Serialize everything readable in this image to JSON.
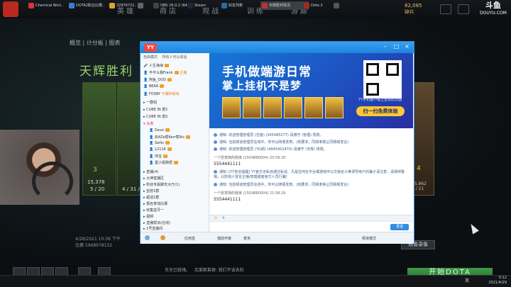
{
  "dota": {
    "nav": [
      "英雄",
      "商店",
      "观战",
      "训练",
      "游廊"
    ],
    "subtabs": "概览  |  计分板  |  图表",
    "victory": "天辉胜利",
    "shards": "82,085",
    "shards_label": "碎片",
    "douyu": "斗鱼",
    "douyu_url": "DOUYU.COM",
    "left_hero_stat_a": "3",
    "left_hero_stat_b": "15,378",
    "left_hero_kda": "5 / 20",
    "left_hero2_kda": "4 / 31 / 18",
    "right_hero_num": "4",
    "right_hero_stat": "15,862",
    "right_hero_kda": "4 / 21",
    "match_date": "4/28/2021 10:36 下午",
    "match_id": "比赛 5968978152",
    "view_button": "观看录像",
    "feed": "东东已就绪。",
    "feed2": "克莱斯莱顿: 我们不该去的",
    "start_button": "开始DOTA"
  },
  "yy": {
    "title_logo": "YY",
    "tabs": [
      "房间",
      "设置",
      "更多"
    ],
    "left_header": "自由模式",
    "left_header_right": "所有人可以说话",
    "users": [
      {
        "name": "人生海海",
        "extra": ""
      },
      {
        "name": "平平么我Frank",
        "extra": "主播"
      },
      {
        "name": "阿鱼_DOD",
        "extra": ""
      },
      {
        "name": "BEAR",
        "extra": ""
      },
      {
        "name": "FOSBY",
        "extra": "不服你就来"
      }
    ],
    "groups": [
      "▸ 一群组",
      "▸ CUBE IN 部1",
      "▸ CUBE IN 部2",
      "▾ 大虎"
    ],
    "sub_users": [
      "Dave",
      "双4Ze帮Kerr帮Ric",
      "Sailis",
      "12116",
      "帅宝",
      "墨小姐随便"
    ],
    "more_groups": [
      "▸ 直播(4)",
      "▸ 大神直播区",
      "▸ 粉丝专属聊天大厅(1)",
      "▸ 监管1群",
      "▸ 超话1群",
      "▸ 报名参加比赛",
      "▸ 收集蓝牙一",
      "▸ 视频",
      "▸ 直播帮派(在线)",
      "   ▸ 1号直播间"
    ],
    "banner_line1": "手机做端游日常",
    "banner_line2": "掌上挂机不是梦",
    "qr_caption": "YY手机客户端上登录此页面",
    "qr_button": "扫一扫免费体验",
    "chat": [
      {
        "type": "sys",
        "text": "通知: 欢迎管理管理员 (住客) (345485277) 请遵守 (管理) 规则。"
      },
      {
        "type": "sys",
        "text": "通知: 当前频道管理员在线中，你可以随便发表。(有要求，同频率禁止同频频发言)"
      },
      {
        "type": "sys",
        "text": "通知: 欢迎管理管理员 (YG频) (4945452470) 请遵守 (天辉) 规则。"
      },
      {
        "type": "me",
        "text": "一个愿意随的我家 (1554880004) 20:59:20"
      },
      {
        "type": "num",
        "text": "5554441111"
      },
      {
        "type": "sys",
        "text": "通知: [YY安全提醒] YY官方无私自通过私信、凡是任何在平台或游戏中以交易名义等诱导用户的骗子请注意，请保持警惕，以防他人冒充主播/管理或者官方人员行骗!"
      },
      {
        "type": "sys",
        "text": "通知: 当前频道管理员在线中，你可以随便发表。(有要求，同频率禁止同频频发言)"
      },
      {
        "type": "me",
        "text": "一个愿意随的我家 (1554880004) 21:58:29"
      },
      {
        "type": "num",
        "text": "5554441111"
      }
    ],
    "input_placeholder": "",
    "send_label": "发送",
    "bottom_items": [
      "应用盒",
      "播放伴奏",
      "麦克"
    ],
    "bottom_right": "频道模式"
  },
  "taskbar": {
    "items": [
      {
        "label": "Chemical Worl..",
        "color": "#d33"
      },
      {
        "label": "DOTA2职业比赛..",
        "color": "#3a7bd5"
      },
      {
        "label": "32976721..",
        "color": "#e8a030"
      },
      {
        "label": "",
        "color": "#666"
      },
      {
        "label": "OBS 26.0.2 (64..",
        "color": "#444"
      },
      {
        "label": "Steam",
        "color": "#1b2838"
      },
      {
        "label": "好友列表",
        "color": "#2d6a9a"
      },
      {
        "label": "天辉胜利情况",
        "color": "#b33"
      },
      {
        "label": "Dota 2",
        "color": "#a52a1e"
      },
      {
        "label": "",
        "color": "#555"
      }
    ],
    "time": "0:12",
    "date": "2021/4/29",
    "lang": "英"
  }
}
